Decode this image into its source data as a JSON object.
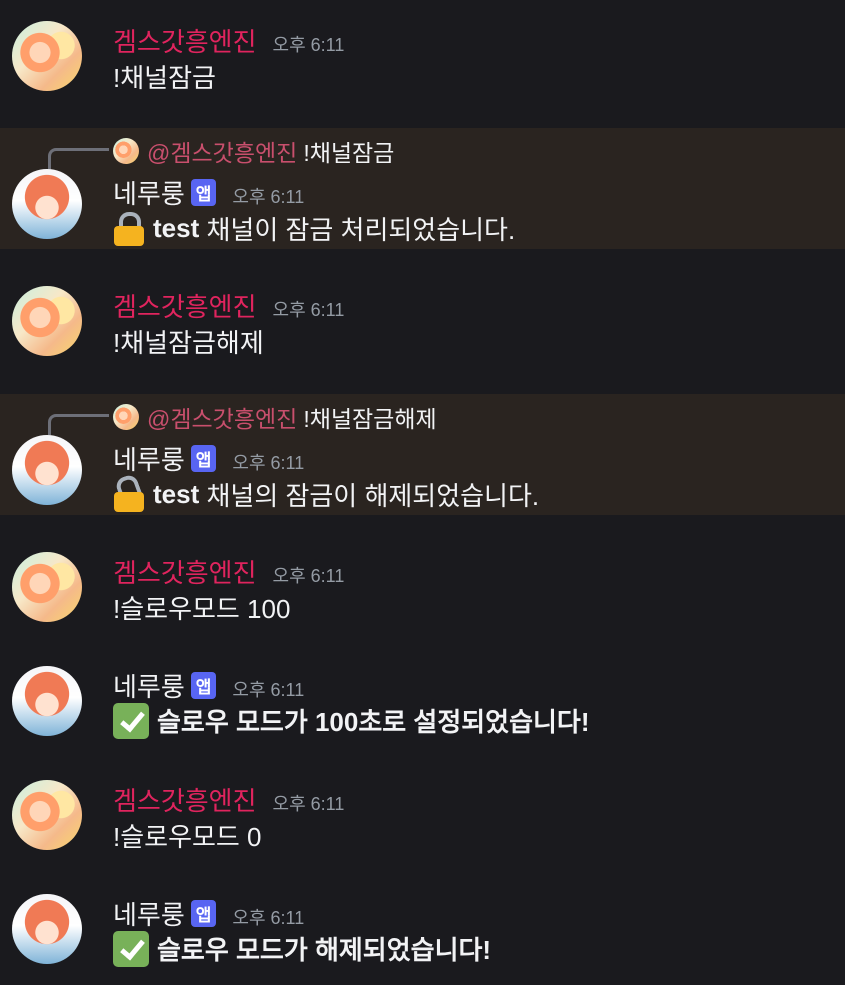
{
  "messages": [
    {
      "author": "겜스갓흥엔진",
      "time": "오후 6:11",
      "text": "!채널잠금"
    },
    {
      "reply": {
        "mention": "@겜스갓흥엔진",
        "text": "!채널잠금"
      },
      "author": "네루룽",
      "badge": "앱",
      "time": "오후 6:11",
      "icon": "locked-padlock-icon",
      "bold": "test",
      "text": " 채널이 잠금 처리되었습니다."
    },
    {
      "author": "겜스갓흥엔진",
      "time": "오후 6:11",
      "text": "!채널잠금해제"
    },
    {
      "reply": {
        "mention": "@겜스갓흥엔진",
        "text": "!채널잠금해제"
      },
      "author": "네루룽",
      "badge": "앱",
      "time": "오후 6:11",
      "icon": "unlocked-padlock-icon",
      "bold": "test",
      "text": " 채널의 잠금이 해제되었습니다."
    },
    {
      "author": "겜스갓흥엔진",
      "time": "오후 6:11",
      "text": "!슬로우모드 100"
    },
    {
      "author": "네루룽",
      "badge": "앱",
      "time": "오후 6:11",
      "icon": "check-mark-icon",
      "text": "슬로우 모드가 100초로 설정되었습니다!"
    },
    {
      "author": "겜스갓흥엔진",
      "time": "오후 6:11",
      "text": "!슬로우모드 0"
    },
    {
      "author": "네루룽",
      "badge": "앱",
      "time": "오후 6:11",
      "icon": "check-mark-icon",
      "text": "슬로우 모드가 해제되었습니다!"
    }
  ],
  "colors": {
    "background": "#1a1a1e",
    "highlight": "#2a2420",
    "user_name": "#e0245e",
    "mention": "#c94f6d",
    "app_badge": "#5865f2"
  }
}
